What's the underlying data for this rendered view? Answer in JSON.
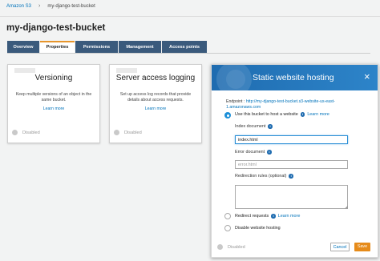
{
  "breadcrumb": {
    "root": "Amazon S3",
    "current": "my-django-test-bucket"
  },
  "page_title": "my-django-test-bucket",
  "tabs": [
    {
      "label": "Overview",
      "active": false
    },
    {
      "label": "Properties",
      "active": true
    },
    {
      "label": "Permissions",
      "active": false
    },
    {
      "label": "Management",
      "active": false
    },
    {
      "label": "Access points",
      "active": false
    }
  ],
  "cards": {
    "versioning": {
      "title": "Versioning",
      "desc": "Keep multiple versions of an object in the same bucket.",
      "learn": "Learn more",
      "status": "Disabled"
    },
    "logging": {
      "title": "Server access logging",
      "desc": "Set up access log records that provide details about access requests.",
      "learn": "Learn more",
      "status": "Disabled"
    }
  },
  "modal": {
    "title": "Static website hosting",
    "close": "×",
    "endpoint_label": "Endpoint :",
    "endpoint_url": "http://my-django-test-bucket.s3-website-us-east-1.amazonaws.com",
    "options": {
      "host": "Use this bucket to host a website",
      "redirect": "Redirect requests",
      "disable": "Disable website hosting"
    },
    "learn_more": "Learn more",
    "index_label": "Index document",
    "index_value": "index.html",
    "error_label": "Error document",
    "error_placeholder": "error.html",
    "redirection_label": "Redirection rules (optional)",
    "status": "Disabled",
    "cancel": "Cancel",
    "save": "Save"
  },
  "icons": {
    "info": "i",
    "resize": "◢"
  },
  "colors": {
    "accent": "#0073bb",
    "tab_bg": "#3a5a7c",
    "save": "#e68b1a",
    "header": "#1f6cb0"
  }
}
